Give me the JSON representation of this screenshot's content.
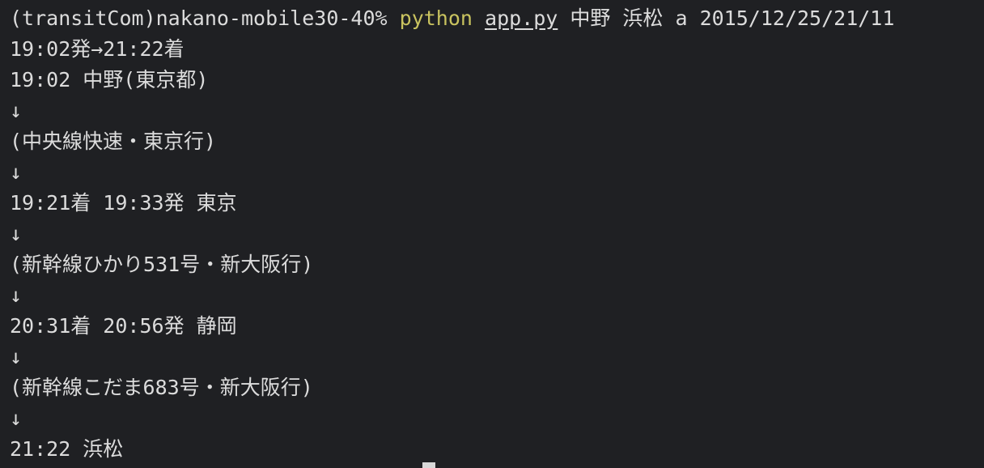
{
  "terminal": {
    "prompt": {
      "user_host": "(transitCom)nakano-mobile30-40% ",
      "command": "python",
      "file": "app.py",
      "args": " 中野 浜松 a 2015/12/25/21/11"
    },
    "output": [
      "19:02発→21:22着",
      "19:02 中野(東京都)",
      "↓",
      "(中央線快速・東京行)",
      "↓",
      "19:21着 19:33発 東京",
      "↓",
      "(新幹線ひかり531号・新大阪行)",
      "↓",
      "20:31着 20:56発 静岡",
      "↓",
      "(新幹線こだま683号・新大阪行)",
      "↓",
      "21:22 浜松"
    ]
  },
  "colors": {
    "background": "#1f2023",
    "text": "#dcdcdc",
    "command": "#c9c35f",
    "cursor": "#d8d8d8"
  }
}
